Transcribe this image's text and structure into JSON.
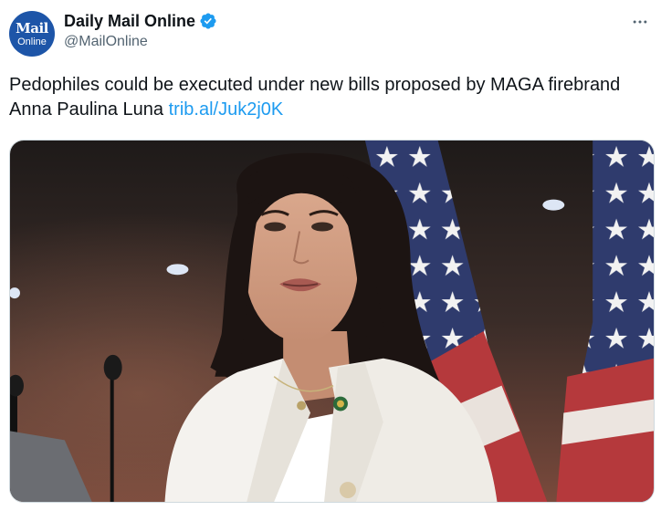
{
  "account": {
    "display_name": "Daily Mail Online",
    "handle": "@MailOnline",
    "avatar": {
      "line1": "Mail",
      "line2": "Online",
      "color": "#1d55a8"
    },
    "verified": true,
    "verified_icon": "verified-badge-icon"
  },
  "menu": {
    "icon": "more-options-icon"
  },
  "tweet": {
    "text": "Pedophiles could be executed under new bills proposed by MAGA firebrand Anna Paulina Luna",
    "link": "trib.al/Juk2j0K"
  },
  "media": {
    "description_icon": "photo",
    "colors": {
      "link": "#1d9bf0",
      "jacket": "#f4f2ee",
      "flag_blue": "#2f3b6d",
      "flag_red": "#b5393c"
    }
  }
}
